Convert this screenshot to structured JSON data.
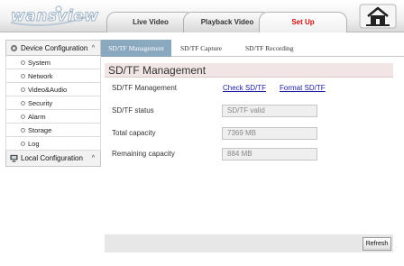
{
  "header": {
    "logo_text": "wansview",
    "tabs": [
      {
        "label": "Live Video"
      },
      {
        "label": "Playback Video"
      },
      {
        "label": "Set Up"
      }
    ]
  },
  "sidebar": {
    "device_configuration": {
      "label": "Device Configuration",
      "caret": "^",
      "items": [
        {
          "label": "System"
        },
        {
          "label": "Network"
        },
        {
          "label": "Video&Audio"
        },
        {
          "label": "Security"
        },
        {
          "label": "Alarm"
        },
        {
          "label": "Storage"
        },
        {
          "label": "Log"
        }
      ]
    },
    "local_configuration": {
      "label": "Local Configuration",
      "caret": "^"
    }
  },
  "subtabs": [
    {
      "label": "SD/TF Management"
    },
    {
      "label": "SD/TF Capture"
    },
    {
      "label": "SD/TF Recording"
    }
  ],
  "panel": {
    "title": "SD/TF Management",
    "management": {
      "label": "SD/TF Management",
      "check_link": "Check SD/TF",
      "format_link": "Format SD/TF"
    },
    "status": {
      "label": "SD/TF status",
      "value": "SD/TF valid"
    },
    "total": {
      "label": "Total capacity",
      "value": "7369 MB"
    },
    "remaining": {
      "label": "Remaining capacity",
      "value": "884 MB"
    },
    "refresh_label": "Refresh"
  },
  "colors": {
    "active_subtab": "#8aa8be",
    "setup_tab_text": "#cc1111",
    "link": "#1a1aa0"
  }
}
